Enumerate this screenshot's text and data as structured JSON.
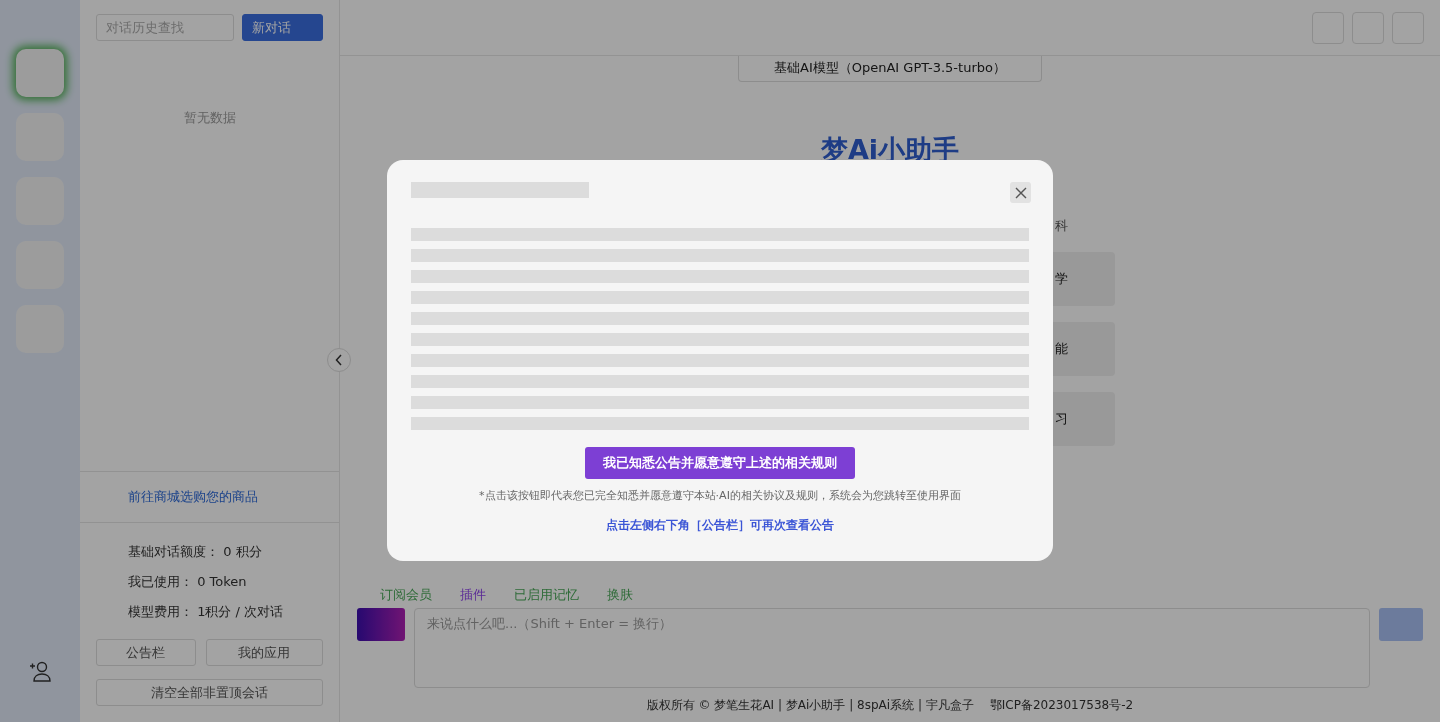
{
  "rail": {
    "apps": [
      {
        "selected": true
      },
      {
        "selected": false
      },
      {
        "selected": false
      },
      {
        "selected": false
      },
      {
        "selected": false
      }
    ]
  },
  "history": {
    "search": {
      "placeholder": "对话历史查找"
    },
    "new_button": "新对话",
    "empty": "暂无数据"
  },
  "shop_link": "前往商城选购您的商品",
  "stats": [
    {
      "label": "基础对话额度：",
      "value": "0 积分"
    },
    {
      "label": "我已使用：",
      "value": "0 Token"
    },
    {
      "label": "模型费用：",
      "value": "1积分 / 次对话"
    }
  ],
  "sidebar_buttons": [
    "公告栏",
    "我的应用"
  ],
  "clear_button": "清空全部非置顶会话",
  "model_selector": "基础AI模型（OpenAI GPT-3.5-turbo）",
  "title": "梦Ai小助手",
  "category_visible": "科",
  "topics_visible": [
    "学",
    "能",
    "习"
  ],
  "toolbar": [
    {
      "label": "订阅会员",
      "color": "#2e6b38"
    },
    {
      "label": "插件",
      "color": "#5b2b96"
    },
    {
      "label": "已启用记忆",
      "color": "#2e6b38"
    },
    {
      "label": "换肤",
      "color": "#2e6b38"
    }
  ],
  "input": {
    "placeholder": "来说点什么吧...（Shift + Enter = 换行）"
  },
  "footer": "版权所有 © 梦笔生花AI | 梦Ai小助手 | 8spAi系统 | 宇凡盒子",
  "icp": "鄂ICP备2023017538号-2",
  "modal": {
    "confirm_button": "我已知悉公告并愿意遵守上述的相关规则",
    "note": "*点击该按钮即代表您已完全知悉并愿意遵守本站·AI的相关协议及规则，系统会为您跳转至使用界面",
    "link": "点击左侧右下角［公告栏］可再次查看公告"
  }
}
